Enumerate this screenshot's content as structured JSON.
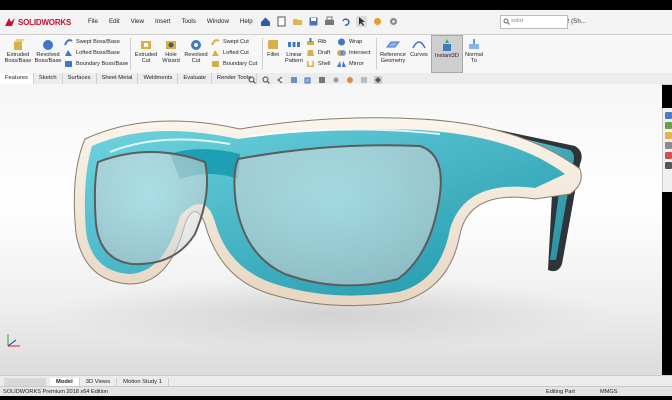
{
  "app": {
    "logo_text": "SOLIDWORKS"
  },
  "menu": [
    "File",
    "Edit",
    "View",
    "Insert",
    "Tools",
    "Window",
    "Help"
  ],
  "document_title": "Spec Design-Jan V2 (Sh...",
  "search": {
    "placeholder": "solid"
  },
  "ribbon": {
    "extruded_boss": "Extruded Boss/Base",
    "revolved_boss": "Revolved Boss/Base",
    "swept_boss": "Swept Boss/Base",
    "lofted_boss": "Lofted Boss/Base",
    "boundary_boss": "Boundary Boss/Base",
    "extruded_cut": "Extruded Cut",
    "hole_wizard": "Hole Wizard",
    "revolved_cut": "Revolved Cut",
    "swept_cut": "Swept Cut",
    "lofted_cut": "Lofted Cut",
    "boundary_cut": "Boundary Cut",
    "fillet": "Fillet",
    "linear_pattern": "Linear Pattern",
    "rib": "Rib",
    "draft": "Draft",
    "shell": "Shell",
    "wrap": "Wrap",
    "intersect": "Intersect",
    "mirror": "Mirror",
    "reference_geometry": "Reference Geometry",
    "curves": "Curves",
    "instant3d": "Instant3D",
    "normal_to": "Normal To"
  },
  "command_tabs": [
    "Features",
    "Sketch",
    "Surfaces",
    "Sheet Metal",
    "Weldments",
    "Evaluate",
    "Render Tools"
  ],
  "bottom_tabs": [
    "Model",
    "3D Views",
    "Motion Study 1"
  ],
  "status": {
    "left": "SOLIDWORKS Premium 2018 x64 Edition",
    "mode": "Editing Part",
    "units": "MMGS"
  },
  "colors": {
    "accent_red": "#c8102e",
    "lens_teal": "#2fb3c6",
    "frame_cream": "#f2e6d6"
  }
}
